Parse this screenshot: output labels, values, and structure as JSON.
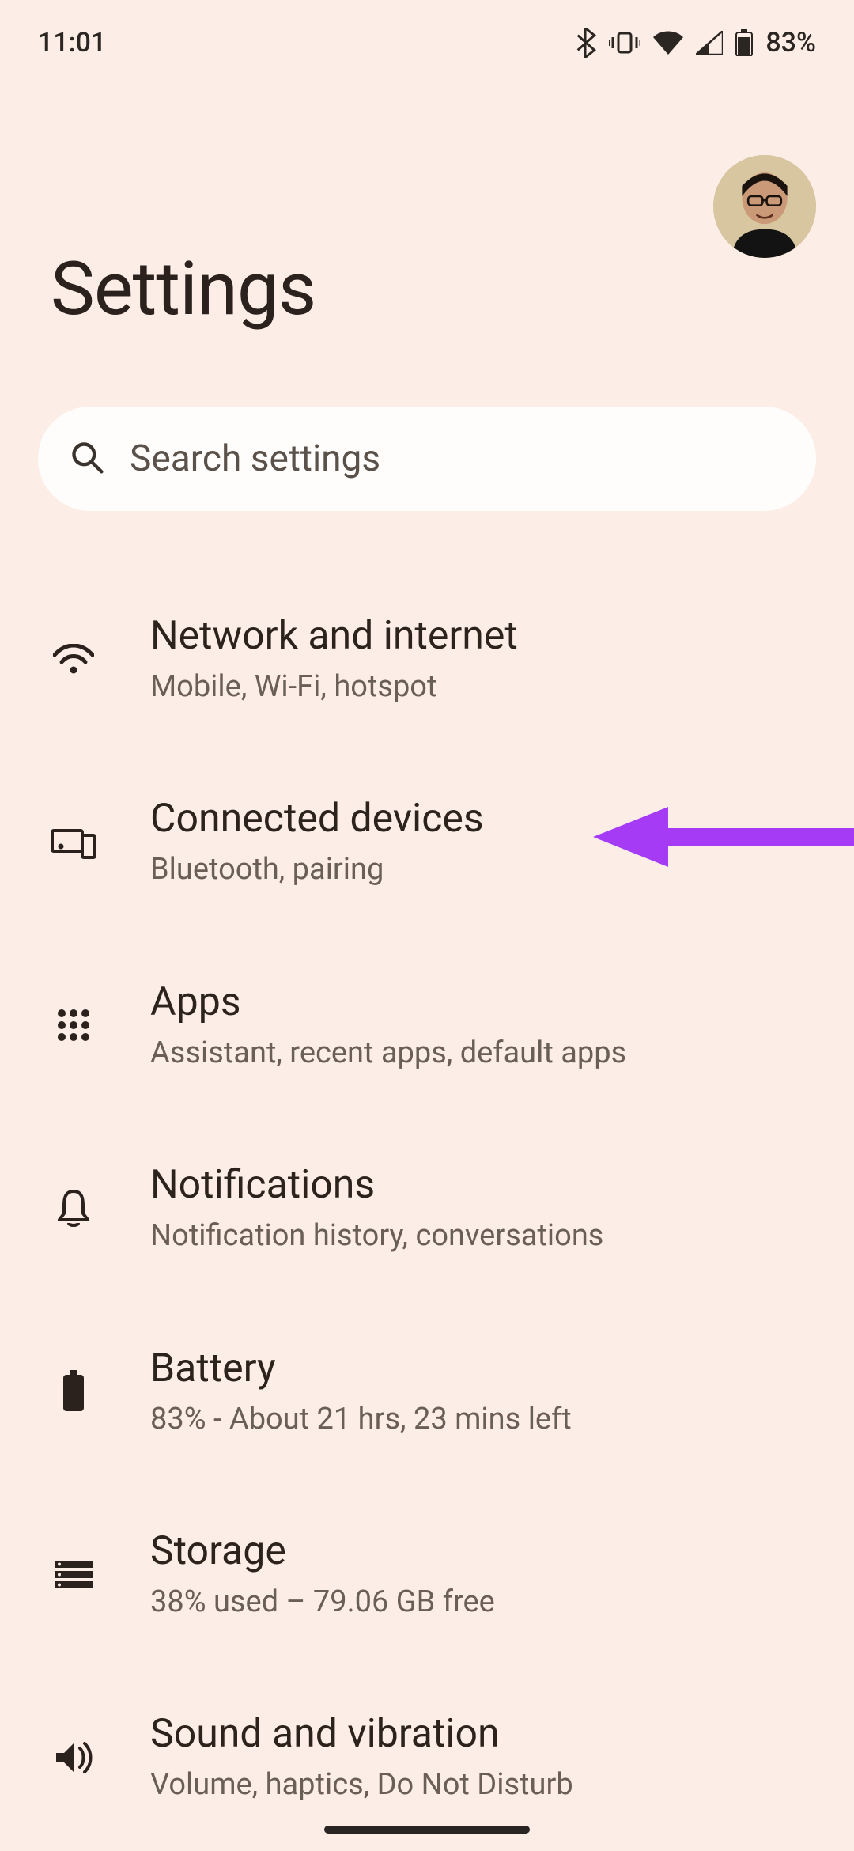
{
  "status": {
    "time": "11:01",
    "battery_text": "83%"
  },
  "header": {
    "title": "Settings"
  },
  "search": {
    "placeholder": "Search settings"
  },
  "settings": [
    {
      "title": "Network and internet",
      "sub": "Mobile, Wi-Fi, hotspot",
      "icon": "wifi-icon",
      "highlighted": false
    },
    {
      "title": "Connected devices",
      "sub": "Bluetooth, pairing",
      "icon": "devices-icon",
      "highlighted": true
    },
    {
      "title": "Apps",
      "sub": "Assistant, recent apps, default apps",
      "icon": "apps-icon",
      "highlighted": false
    },
    {
      "title": "Notifications",
      "sub": "Notification history, conversations",
      "icon": "bell-icon",
      "highlighted": false
    },
    {
      "title": "Battery",
      "sub": "83% - About 21 hrs, 23 mins left",
      "icon": "battery-icon",
      "highlighted": false
    },
    {
      "title": "Storage",
      "sub": "38% used – 79.06 GB free",
      "icon": "storage-icon",
      "highlighted": false
    },
    {
      "title": "Sound and vibration",
      "sub": "Volume, haptics, Do Not Disturb",
      "icon": "sound-icon",
      "highlighted": false
    }
  ],
  "colors": {
    "bg": "#fceee7",
    "text": "#2d2a27",
    "subtext": "#6a5f57",
    "arrow": "#a63bf5"
  }
}
